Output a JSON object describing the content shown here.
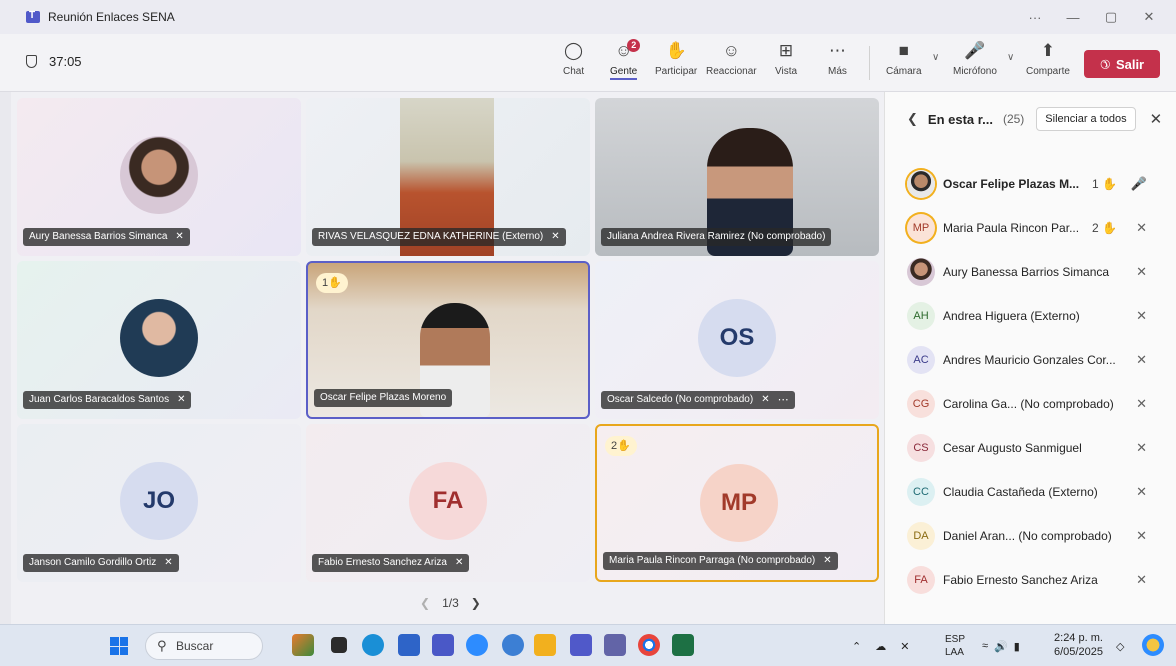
{
  "window": {
    "title": "Reunión Enlaces SENA",
    "controls": [
      "···",
      "—",
      "▢",
      "✕"
    ]
  },
  "toolbar": {
    "timer": "37:05",
    "buttons": [
      {
        "label": "Chat",
        "icon": "chat-icon"
      },
      {
        "label": "Gente",
        "icon": "people-icon",
        "badge": "2"
      },
      {
        "label": "Participar",
        "icon": "raise-hand-icon"
      },
      {
        "label": "Reaccionar",
        "icon": "smiley-icon"
      },
      {
        "label": "Vista",
        "icon": "grid-view-icon"
      },
      {
        "label": "Más",
        "icon": "more-icon"
      },
      {
        "label": "Cámara",
        "icon": "camera-off-icon"
      },
      {
        "label": "Micrófono",
        "icon": "mic-off-icon"
      },
      {
        "label": "Comparte",
        "icon": "share-icon"
      }
    ],
    "leave_label": "Salir"
  },
  "tiles": [
    {
      "name": "Aury Banessa Barrios Simanca"
    },
    {
      "name": "RIVAS VELASQUEZ EDNA KATHERINE (Externo)"
    },
    {
      "name": "Juliana Andrea Rivera Ramirez (No comprobado)"
    },
    {
      "name": "Juan Carlos Baracaldos Santos"
    },
    {
      "name": "Oscar Felipe Plazas Moreno",
      "hand": "1"
    },
    {
      "name": "Oscar Salcedo (No comprobado)",
      "initials": "OS"
    },
    {
      "name": "Janson Camilo Gordillo Ortiz",
      "initials": "JO"
    },
    {
      "name": "Fabio Ernesto Sanchez Ariza",
      "initials": "FA"
    },
    {
      "name": "Maria Paula Rincon Parraga (No comprobado)",
      "initials": "MP",
      "hand": "2"
    }
  ],
  "pager": {
    "text": "1/3"
  },
  "panel": {
    "title": "En esta r...",
    "count": "(25)",
    "mute_all": "Silenciar a todos",
    "participants": [
      {
        "name": "Oscar Felipe Plazas M...",
        "hand": "1"
      },
      {
        "initials": "MP",
        "name": "Maria Paula Rincon Par...",
        "hand": "2"
      },
      {
        "name": "Aury Banessa Barrios Simanca"
      },
      {
        "initials": "AH",
        "name": "Andrea Higuera (Externo)"
      },
      {
        "initials": "AC",
        "name": "Andres Mauricio Gonzales Cor..."
      },
      {
        "initials": "CG",
        "name": "Carolina Ga...",
        "status": "(No comprobado)"
      },
      {
        "initials": "CS",
        "name": "Cesar Augusto Sanmiguel"
      },
      {
        "initials": "CC",
        "name": "Claudia Castañeda (Externo)"
      },
      {
        "initials": "DA",
        "name": "Daniel Aran...",
        "status": "(No comprobado)"
      },
      {
        "initials": "FA",
        "name": "Fabio Ernesto Sanchez Ariza"
      }
    ]
  },
  "taskbar": {
    "search_placeholder": "Buscar",
    "lang_1": "ESP",
    "lang_2": "LAA",
    "time": "2:24 p. m.",
    "date": "6/05/2025"
  }
}
